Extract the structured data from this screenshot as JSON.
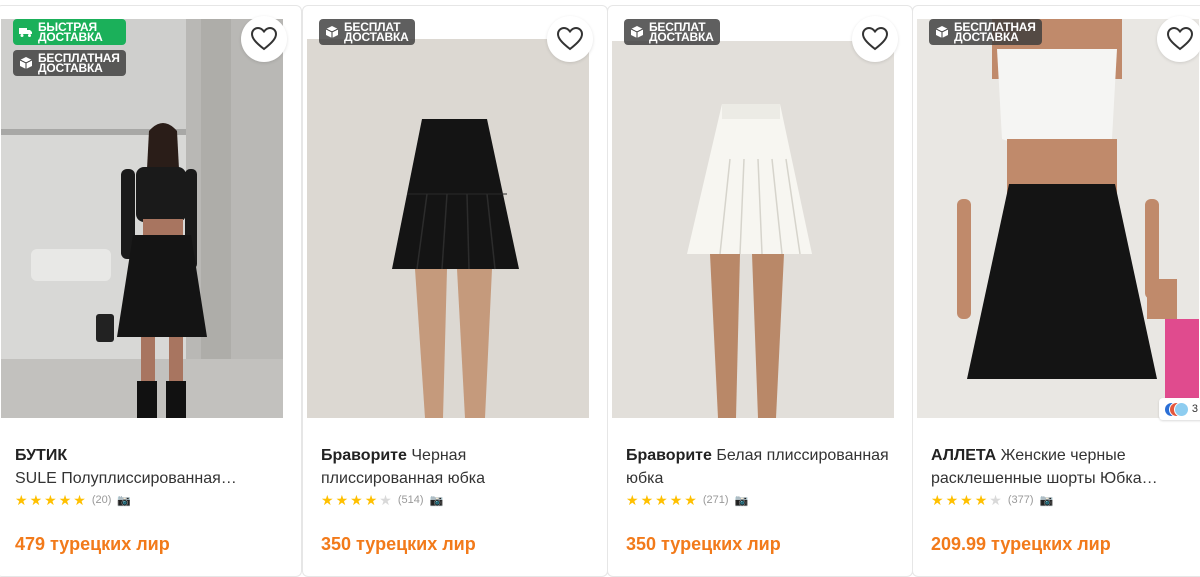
{
  "products": [
    {
      "badges": [
        {
          "icon": "truck-icon",
          "line1": "БЫСТРАЯ",
          "line2": "ДОСТАВКА",
          "color": "#1bb05a"
        },
        {
          "icon": "package-icon",
          "line1": "БЕСПЛАТНАЯ",
          "line2": "ДОСТАВКА",
          "color": "#3c3c3c"
        }
      ],
      "brand": "БУТИК",
      "name": "SULE Полуплиссированная…",
      "rating_count": "(20)",
      "rating": 4.5,
      "price": "479 турецких лир"
    },
    {
      "badges": [
        {
          "icon": "package-icon",
          "line1": "БЕСПЛАТ",
          "line2": "ДОСТАВКА",
          "color": "#3c3c3c"
        }
      ],
      "brand": "Браворите",
      "name": "Черная плиссированная юбка",
      "rating_count": "(514)",
      "rating": 4.0,
      "price": "350 турецких лир"
    },
    {
      "badges": [
        {
          "icon": "package-icon",
          "line1": "БЕСПЛАТ",
          "line2": "ДОСТАВКА",
          "color": "#3c3c3c"
        }
      ],
      "brand": "Браворите",
      "name": "Белая плиссированная юбка",
      "rating_count": "(271)",
      "rating": 4.5,
      "price": "350 турецких лир"
    },
    {
      "badges": [
        {
          "icon": "package-icon",
          "line1": "БЕСПЛАТНАЯ",
          "line2": "ДОСТАВКА",
          "color": "#3c3c3c"
        }
      ],
      "brand": "АЛЛЕТА",
      "name": "Женские черные расклешенные шорты Юбка…",
      "rating_count": "(377)",
      "rating": 4.0,
      "price": "209.99 турецких лир",
      "color_variants": "3"
    }
  ],
  "colors": {
    "price": "#f27a1a",
    "star": "#ffc000",
    "fast_badge": "#1bb05a"
  }
}
